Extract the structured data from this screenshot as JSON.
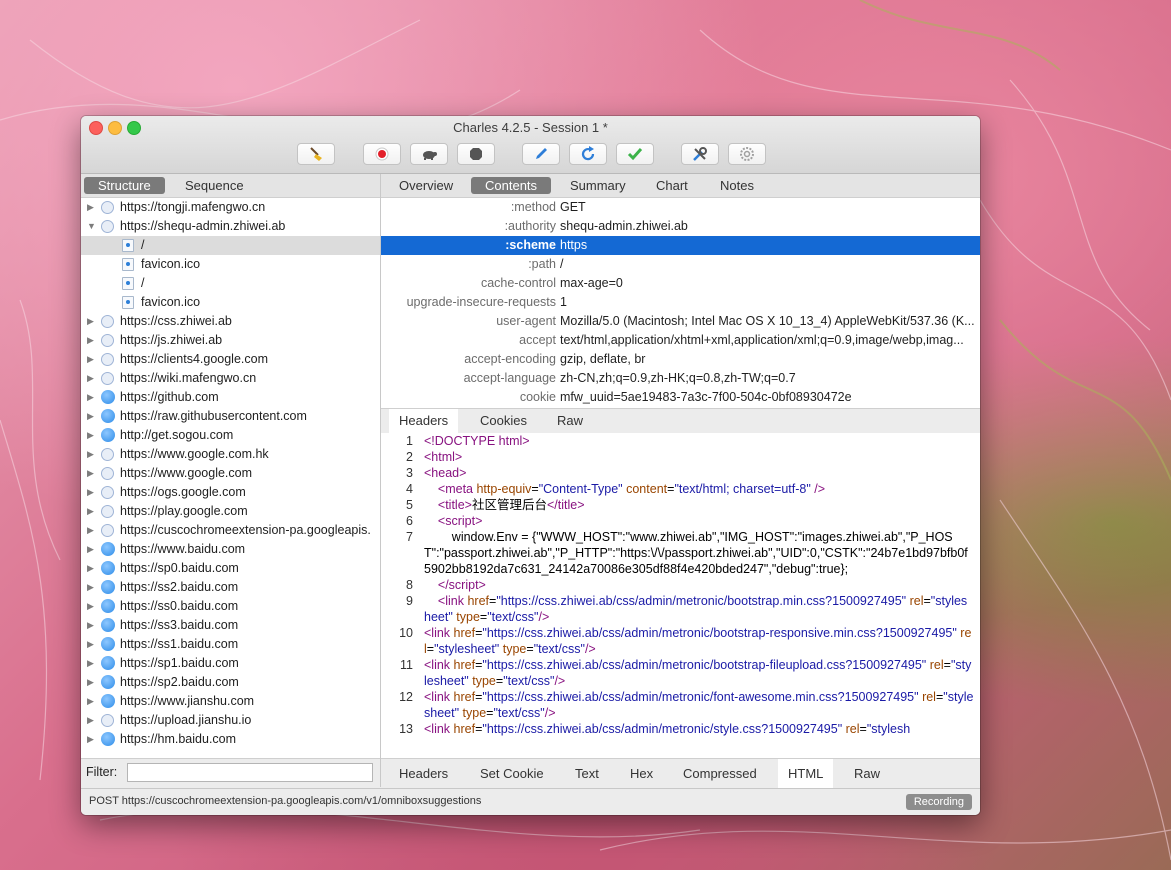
{
  "window": {
    "title": "Charles 4.2.5 - Session 1 *"
  },
  "toolbar": {
    "buttons": [
      {
        "icon": "broom-icon"
      },
      {
        "icon": "record-icon"
      },
      {
        "icon": "turtle-icon"
      },
      {
        "icon": "stop-icon"
      },
      {
        "icon": "pen-icon"
      },
      {
        "icon": "refresh-icon"
      },
      {
        "icon": "check-icon"
      },
      {
        "icon": "tools-icon"
      },
      {
        "icon": "gear-icon"
      }
    ]
  },
  "left": {
    "tabs": [
      "Structure",
      "Sequence"
    ],
    "active_tab": "Structure",
    "tree": [
      {
        "label": "https://tongji.mafengwo.cn",
        "icon": "bolt",
        "expanded": false
      },
      {
        "label": "https://shequ-admin.zhiwei.ab",
        "icon": "bolt",
        "expanded": true
      },
      {
        "label": "/",
        "icon": "file",
        "child": true,
        "selected": true
      },
      {
        "label": "favicon.ico",
        "icon": "file",
        "child": true
      },
      {
        "label": "/",
        "icon": "file",
        "child": true
      },
      {
        "label": "favicon.ico",
        "icon": "file",
        "child": true
      },
      {
        "label": "https://css.zhiwei.ab",
        "icon": "bolt"
      },
      {
        "label": "https://js.zhiwei.ab",
        "icon": "bolt"
      },
      {
        "label": "https://clients4.google.com",
        "icon": "bolt"
      },
      {
        "label": "https://wiki.mafengwo.cn",
        "icon": "bolt"
      },
      {
        "label": "https://github.com",
        "icon": "globe"
      },
      {
        "label": "https://raw.githubusercontent.com",
        "icon": "globe"
      },
      {
        "label": "http://get.sogou.com",
        "icon": "globe"
      },
      {
        "label": "https://www.google.com.hk",
        "icon": "bolt"
      },
      {
        "label": "https://www.google.com",
        "icon": "bolt"
      },
      {
        "label": "https://ogs.google.com",
        "icon": "bolt"
      },
      {
        "label": "https://play.google.com",
        "icon": "bolt"
      },
      {
        "label": "https://cuscochromeextension-pa.googleapis.",
        "icon": "bolt"
      },
      {
        "label": "https://www.baidu.com",
        "icon": "globe"
      },
      {
        "label": "https://sp0.baidu.com",
        "icon": "globe"
      },
      {
        "label": "https://ss2.baidu.com",
        "icon": "globe"
      },
      {
        "label": "https://ss0.baidu.com",
        "icon": "globe"
      },
      {
        "label": "https://ss3.baidu.com",
        "icon": "globe"
      },
      {
        "label": "https://ss1.baidu.com",
        "icon": "globe"
      },
      {
        "label": "https://sp1.baidu.com",
        "icon": "globe"
      },
      {
        "label": "https://sp2.baidu.com",
        "icon": "globe"
      },
      {
        "label": "https://www.jianshu.com",
        "icon": "globe"
      },
      {
        "label": "https://upload.jianshu.io",
        "icon": "bolt"
      },
      {
        "label": "https://hm.baidu.com",
        "icon": "globe"
      }
    ],
    "filter_label": "Filter:",
    "filter_value": ""
  },
  "right": {
    "tabs": [
      "Overview",
      "Contents",
      "Summary",
      "Chart",
      "Notes"
    ],
    "active_tab": "Contents",
    "headers": [
      {
        "key": ":method",
        "value": "GET"
      },
      {
        "key": ":authority",
        "value": "shequ-admin.zhiwei.ab"
      },
      {
        "key": ":scheme",
        "value": "https",
        "selected": true
      },
      {
        "key": ":path",
        "value": "/"
      },
      {
        "key": "cache-control",
        "value": "max-age=0"
      },
      {
        "key": "upgrade-insecure-requests",
        "value": "1"
      },
      {
        "key": "user-agent",
        "value": "Mozilla/5.0 (Macintosh; Intel Mac OS X 10_13_4) AppleWebKit/537.36 (K..."
      },
      {
        "key": "accept",
        "value": "text/html,application/xhtml+xml,application/xml;q=0.9,image/webp,imag..."
      },
      {
        "key": "accept-encoding",
        "value": "gzip, deflate, br"
      },
      {
        "key": "accept-language",
        "value": "zh-CN,zh;q=0.9,zh-HK;q=0.8,zh-TW;q=0.7"
      },
      {
        "key": "cookie",
        "value": "mfw_uuid=5ae19483-7a3c-7f00-504c-0bf08930472e"
      }
    ],
    "request_subtabs": [
      "Headers",
      "Cookies",
      "Raw"
    ],
    "request_active": "Headers",
    "code_lines": [
      {
        "n": "1",
        "html": "<span class=\"tagc\">&lt;!DOCTYPE html&gt;</span>"
      },
      {
        "n": "2",
        "html": "<span class=\"tagc\">&lt;html&gt;</span>"
      },
      {
        "n": "3",
        "html": "<span class=\"tagc\">&lt;head&gt;</span>"
      },
      {
        "n": "4",
        "html": "    <span class=\"tagc\">&lt;meta</span> <span class=\"attr\">http-equiv</span>=<span class=\"val\">\"Content-Type\"</span> <span class=\"attr\">content</span>=<span class=\"val\">\"text/html; charset=utf-8\"</span> <span class=\"tagc\">/&gt;</span>"
      },
      {
        "n": "5",
        "html": "    <span class=\"tagc\">&lt;title&gt;</span>社区管理后台<span class=\"tagc\">&lt;/title&gt;</span>"
      },
      {
        "n": "6",
        "html": "    <span class=\"tagc\">&lt;script&gt;</span>"
      },
      {
        "n": "7",
        "html": "        window.Env = {\"WWW_HOST\":\"www.zhiwei.ab\",\"IMG_HOST\":\"images.zhiwei.ab\",\"P_HOST\":\"passport.zhiwei.ab\",\"P_HTTP\":\"https:\\/\\/passport.zhiwei.ab\",\"UID\":0,\"CSTK\":\"24b7e1bd97bfb0f5902bb8192da7c631_24142a70086e305df88f4e420bded247\",\"debug\":true};"
      },
      {
        "n": "8",
        "html": "    <span class=\"tagc\">&lt;/script&gt;</span>"
      },
      {
        "n": "9",
        "html": "    <span class=\"tagc\">&lt;link</span> <span class=\"attr\">href</span>=<span class=\"val\">\"https://css.zhiwei.ab/css/admin/metronic/bootstrap.min.css?1500927495\"</span> <span class=\"attr\">rel</span>=<span class=\"val\">\"stylesheet\"</span> <span class=\"attr\">type</span>=<span class=\"val\">\"text/css\"</span><span class=\"tagc\">/&gt;</span>"
      },
      {
        "n": "10",
        "html": "<span class=\"tagc\">&lt;link</span> <span class=\"attr\">href</span>=<span class=\"val\">\"https://css.zhiwei.ab/css/admin/metronic/bootstrap-responsive.min.css?1500927495\"</span> <span class=\"attr\">rel</span>=<span class=\"val\">\"stylesheet\"</span> <span class=\"attr\">type</span>=<span class=\"val\">\"text/css\"</span><span class=\"tagc\">/&gt;</span>"
      },
      {
        "n": "11",
        "html": "<span class=\"tagc\">&lt;link</span> <span class=\"attr\">href</span>=<span class=\"val\">\"https://css.zhiwei.ab/css/admin/metronic/bootstrap-fileupload.css?1500927495\"</span> <span class=\"attr\">rel</span>=<span class=\"val\">\"stylesheet\"</span> <span class=\"attr\">type</span>=<span class=\"val\">\"text/css\"</span><span class=\"tagc\">/&gt;</span>"
      },
      {
        "n": "12",
        "html": "<span class=\"tagc\">&lt;link</span> <span class=\"attr\">href</span>=<span class=\"val\">\"https://css.zhiwei.ab/css/admin/metronic/font-awesome.min.css?1500927495\"</span> <span class=\"attr\">rel</span>=<span class=\"val\">\"stylesheet\"</span> <span class=\"attr\">type</span>=<span class=\"val\">\"text/css\"</span><span class=\"tagc\">/&gt;</span>"
      },
      {
        "n": "13",
        "html": "<span class=\"tagc\">&lt;link</span> <span class=\"attr\">href</span>=<span class=\"val\">\"https://css.zhiwei.ab/css/admin/metronic/style.css?1500927495\"</span> <span class=\"attr\">rel</span>=<span class=\"val\">\"stylesh</span>"
      }
    ],
    "response_subtabs": [
      "Headers",
      "Set Cookie",
      "Text",
      "Hex",
      "Compressed",
      "HTML",
      "Raw"
    ],
    "response_active": "HTML"
  },
  "status": {
    "text": "POST https://cuscochromeextension-pa.googleapis.com/v1/omniboxsuggestions",
    "badge": "Recording"
  }
}
